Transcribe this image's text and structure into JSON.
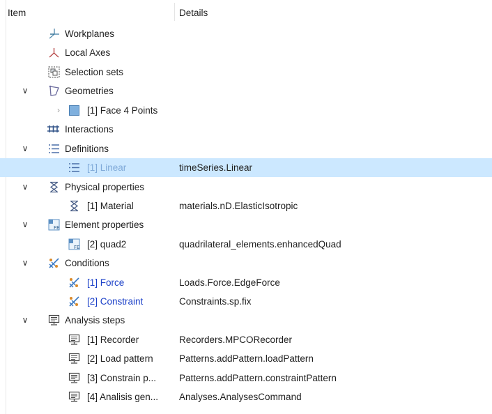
{
  "header": {
    "item": "Item",
    "details": "Details"
  },
  "rows": [
    {
      "label": "Workplanes",
      "details": ""
    },
    {
      "label": "Local Axes",
      "details": ""
    },
    {
      "label": "Selection sets",
      "details": ""
    },
    {
      "label": "Geometries",
      "details": ""
    },
    {
      "label": "[1] Face 4 Points",
      "details": ""
    },
    {
      "label": "Interactions",
      "details": ""
    },
    {
      "label": "Definitions",
      "details": ""
    },
    {
      "label": "[1] Linear",
      "details": "timeSeries.Linear"
    },
    {
      "label": "Physical properties",
      "details": ""
    },
    {
      "label": "[1] Material",
      "details": "materials.nD.ElasticIsotropic"
    },
    {
      "label": "Element properties",
      "details": ""
    },
    {
      "label": "[2] quad2",
      "details": "quadrilateral_elements.enhancedQuad"
    },
    {
      "label": "Conditions",
      "details": ""
    },
    {
      "label": "[1] Force",
      "details": "Loads.Force.EdgeForce"
    },
    {
      "label": "[2] Constraint",
      "details": "Constraints.sp.fix"
    },
    {
      "label": "Analysis steps",
      "details": ""
    },
    {
      "label": "[1] Recorder",
      "details": "Recorders.MPCORecorder"
    },
    {
      "label": "[2] Load pattern",
      "details": "Patterns.addPattern.loadPattern"
    },
    {
      "label": "[3] Constrain p...",
      "details": "Patterns.addPattern.constraintPattern"
    },
    {
      "label": "[4] Analisis gen...",
      "details": "Analyses.AnalysesCommand"
    }
  ],
  "colors": {
    "selection": "#cce8ff",
    "link_blue": "#1a3fc8",
    "muted_blue": "#7fa9d8"
  }
}
